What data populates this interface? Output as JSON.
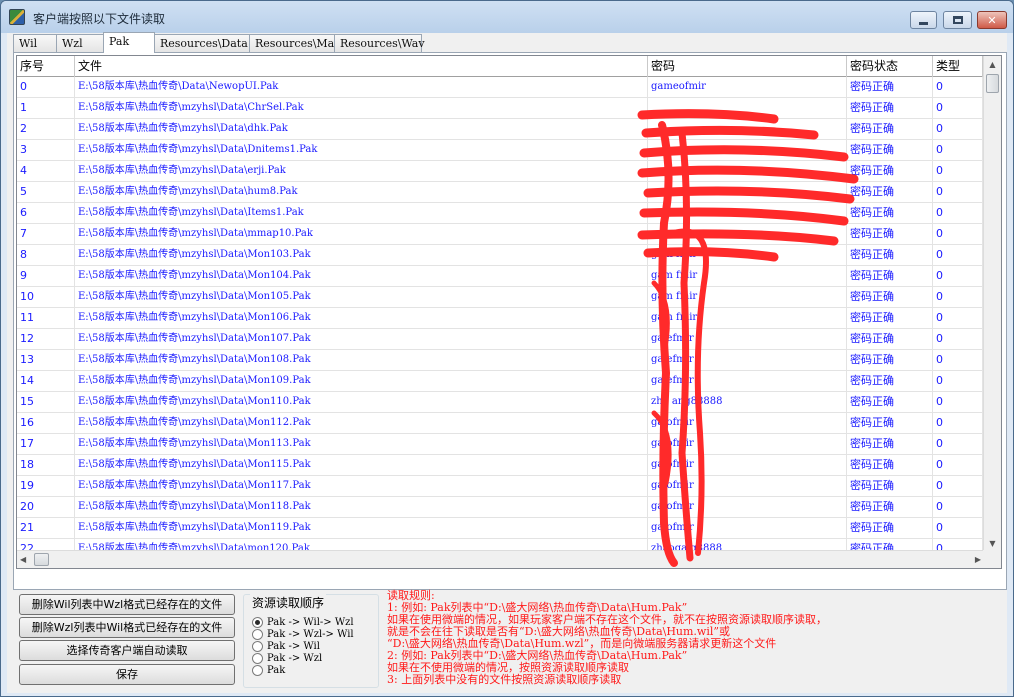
{
  "window": {
    "title": "客户端按照以下文件读取"
  },
  "tabs": [
    {
      "label": "Wil",
      "active": false
    },
    {
      "label": "Wzl",
      "active": false
    },
    {
      "label": "Pak",
      "active": true
    },
    {
      "label": "Resources\\Data",
      "active": false
    },
    {
      "label": "Resources\\Map",
      "active": false
    },
    {
      "label": "Resources\\Wav",
      "active": false
    }
  ],
  "table": {
    "columns": [
      "序号",
      "文件",
      "密码",
      "密码状态",
      "类型"
    ],
    "rows": [
      [
        "0",
        "E:\\58版本库\\热血传奇\\Data\\NewopUI.Pak",
        "gameofmir",
        "密码正确",
        "0"
      ],
      [
        "1",
        "E:\\58版本库\\热血传奇\\mzyhsl\\Data\\ChrSel.Pak",
        "",
        "密码正确",
        "0"
      ],
      [
        "2",
        "E:\\58版本库\\热血传奇\\mzyhsl\\Data\\dhk.Pak",
        "",
        "密码正确",
        "0"
      ],
      [
        "3",
        "E:\\58版本库\\热血传奇\\mzyhsl\\Data\\Dnitems1.Pak",
        "",
        "密码正确",
        "0"
      ],
      [
        "4",
        "E:\\58版本库\\热血传奇\\mzyhsl\\Data\\erji.Pak",
        "",
        "密码正确",
        "0"
      ],
      [
        "5",
        "E:\\58版本库\\热血传奇\\mzyhsl\\Data\\hum8.Pak",
        "",
        "密码正确",
        "0"
      ],
      [
        "6",
        "E:\\58版本库\\热血传奇\\mzyhsl\\Data\\Items1.Pak",
        "",
        "密码正确",
        "0"
      ],
      [
        "7",
        "E:\\58版本库\\热血传奇\\mzyhsl\\Data\\mmap10.Pak",
        "",
        "密码正确",
        "0"
      ],
      [
        "8",
        "E:\\58版本库\\热血传奇\\mzyhsl\\Data\\Mon103.Pak",
        "gam  fmir",
        "密码正确",
        "0"
      ],
      [
        "9",
        "E:\\58版本库\\热血传奇\\mzyhsl\\Data\\Mon104.Pak",
        "gam  fmir",
        "密码正确",
        "0"
      ],
      [
        "10",
        "E:\\58版本库\\热血传奇\\mzyhsl\\Data\\Mon105.Pak",
        "gam  fmir",
        "密码正确",
        "0"
      ],
      [
        "11",
        "E:\\58版本库\\热血传奇\\mzyhsl\\Data\\Mon106.Pak",
        "gam  fmir",
        "密码正确",
        "0"
      ],
      [
        "12",
        "E:\\58版本库\\热血传奇\\mzyhsl\\Data\\Mon107.Pak",
        "ga  efmir",
        "密码正确",
        "0"
      ],
      [
        "13",
        "E:\\58版本库\\热血传奇\\mzyhsl\\Data\\Mon108.Pak",
        "ga  efmir",
        "密码正确",
        "0"
      ],
      [
        "14",
        "E:\\58版本库\\热血传奇\\mzyhsl\\Data\\Mon109.Pak",
        "ga  efmir",
        "密码正确",
        "0"
      ],
      [
        "15",
        "E:\\58版本库\\热血传奇\\mzyhsl\\Data\\Mon110.Pak",
        "zha ang88888",
        "密码正确",
        "0"
      ],
      [
        "16",
        "E:\\58版本库\\热血传奇\\mzyhsl\\Data\\Mon112.Pak",
        "ga  ofmir",
        "密码正确",
        "0"
      ],
      [
        "17",
        "E:\\58版本库\\热血传奇\\mzyhsl\\Data\\Mon113.Pak",
        "ga  ofmir",
        "密码正确",
        "0"
      ],
      [
        "18",
        "E:\\58版本库\\热血传奇\\mzyhsl\\Data\\Mon115.Pak",
        "ga  ofmir",
        "密码正确",
        "0"
      ],
      [
        "19",
        "E:\\58版本库\\热血传奇\\mzyhsl\\Data\\Mon117.Pak",
        "ga  ofmir",
        "密码正确",
        "0"
      ],
      [
        "20",
        "E:\\58版本库\\热血传奇\\mzyhsl\\Data\\Mon118.Pak",
        "ga  ofmir",
        "密码正确",
        "0"
      ],
      [
        "21",
        "E:\\58版本库\\热血传奇\\mzyhsl\\Data\\Mon119.Pak",
        "ga  ofmir",
        "密码正确",
        "0"
      ],
      [
        "22",
        "E:\\58版本库\\热血传奇\\mzyhsl\\Data\\mon120.Pak",
        "zhaoga g8888",
        "密码正确",
        "0"
      ],
      [
        "23",
        "",
        "",
        "",
        ""
      ]
    ]
  },
  "buttons": {
    "delete_wil": "删除Wil列表中Wzl格式已经存在的文件",
    "delete_wzl": "删除Wzl列表中Wil格式已经存在的文件",
    "select_client": "选择传奇客户端自动读取",
    "save": "保存"
  },
  "read_order": {
    "title": "资源读取顺序",
    "options": [
      {
        "label": "Pak -> Wil-> Wzl",
        "checked": true
      },
      {
        "label": "Pak -> Wzl-> Wil",
        "checked": false
      },
      {
        "label": "Pak -> Wil",
        "checked": false
      },
      {
        "label": "Pak -> Wzl",
        "checked": false
      },
      {
        "label": "Pak",
        "checked": false
      }
    ]
  },
  "rules": {
    "lines": [
      "读取规则:",
      "1: 例如: Pak列表中“D:\\盛大网络\\热血传奇\\Data\\Hum.Pak”",
      "    如果在使用微端的情况，如果玩家客户端不存在这个文件，就不在按照资源读取顺序读取，",
      "    就是不会在往下读取是否有“D:\\盛大网络\\热血传奇\\Data\\Hum.wil”或",
      "  “D:\\盛大网络\\热血传奇\\Data\\Hum.wzl”，而是向微端服务器请求更新这个文件",
      "2: 例如: Pak列表中“D:\\盛大网络\\热血传奇\\Data\\Hum.Pak”",
      "    如果在不使用微端的情况，按照资源读取顺序读取",
      "3: 上面列表中没有的文件按照资源读取顺序读取"
    ]
  },
  "colors": {
    "cell_text": "#1a1aff",
    "rules_text": "#ff1a1a",
    "scribble": "#ff2a2a"
  }
}
